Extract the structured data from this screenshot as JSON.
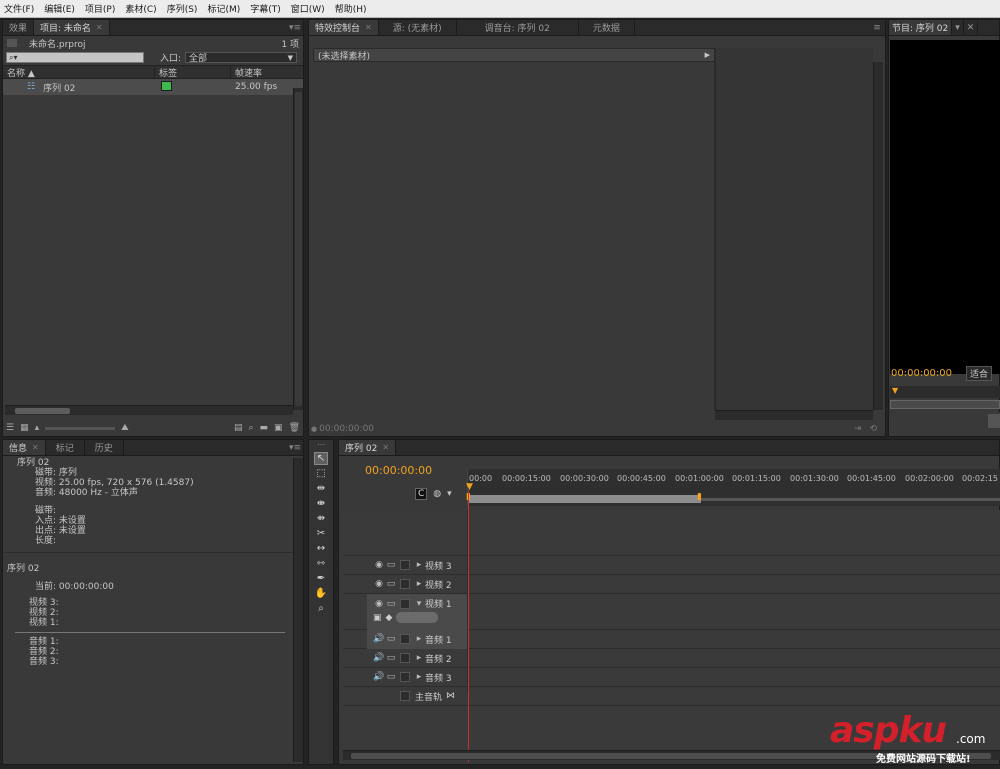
{
  "menu": [
    "文件(F)",
    "编辑(E)",
    "项目(P)",
    "素材(C)",
    "序列(S)",
    "标记(M)",
    "字幕(T)",
    "窗口(W)",
    "帮助(H)"
  ],
  "project_panel": {
    "tabs": [
      "效果",
      "项目: 未命名"
    ],
    "filename": "未命名.prproj",
    "count": "1 项",
    "entry_label": "入口:",
    "entry_value": "全部",
    "columns": [
      "名称",
      "标签",
      "帧速率"
    ],
    "item_name": "序列 02",
    "item_fps": "25.00 fps",
    "label_color": "#3dba4e"
  },
  "effect_controls": {
    "tabs": [
      "特效控制台",
      "源: (无素材)",
      "调音台: 序列 02",
      "元数据"
    ],
    "no_clip": "(未选择素材)",
    "timecode": "00:00:00:00"
  },
  "program_monitor": {
    "tab": "节目: 序列 02",
    "timecode": "00:00:00:00",
    "fit": "适合"
  },
  "info_panel": {
    "tabs": [
      "信息",
      "标记",
      "历史"
    ],
    "title": "序列 02",
    "lines": [
      "磁带: 序列",
      "视频: 25.00 fps, 720 x 576 (1.4587)",
      "音频: 48000 Hz - 立体声"
    ],
    "lines2": [
      "磁带:",
      "入点: 未设置",
      "出点: 未设置",
      "长度:"
    ],
    "seq_title": "序列 02",
    "current": "当前: 00:00:00:00",
    "video_tracks": [
      "视频 3:",
      "视频 2:",
      "视频 1:"
    ],
    "audio_tracks": [
      "音频 1:",
      "音频 2:",
      "音频 3:"
    ]
  },
  "timeline": {
    "tab": "序列 02",
    "timecode": "00:00:00:00",
    "ticks": [
      "00:00",
      "00:00:15:00",
      "00:00:30:00",
      "00:00:45:00",
      "00:01:00:00",
      "00:01:15:00",
      "00:01:30:00",
      "00:01:45:00",
      "00:02:00:00",
      "00:02:15"
    ],
    "tracks": {
      "v3": "视频 3",
      "v2": "视频 2",
      "v1": "视频 1",
      "a1": "音频 1",
      "a2": "音频 2",
      "a3": "音频 3",
      "master": "主音轨"
    }
  },
  "watermark": {
    "brand": "aspku",
    "suffix": ".com",
    "tagline": "免费网站源码下载站!"
  },
  "colors": {
    "accent": "#f0a41f",
    "playhead": "#c8322e",
    "watermark": "#d4202a"
  }
}
